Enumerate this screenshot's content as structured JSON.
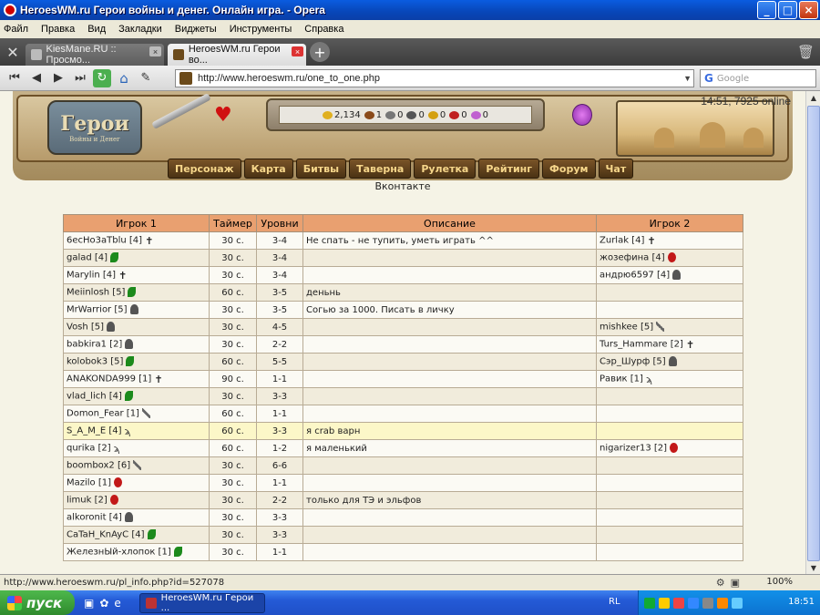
{
  "window": {
    "title": "HeroesWM.ru Герои войны и денег. Онлайн игра. - Opera",
    "minimize": "_",
    "maximize": "□",
    "close": "×"
  },
  "menu": [
    "Файл",
    "Правка",
    "Вид",
    "Закладки",
    "Виджеты",
    "Инструменты",
    "Справка"
  ],
  "tabs": [
    {
      "label": "KiesMane.RU :: Просмо...",
      "active": false
    },
    {
      "label": "HeroesWM.ru Герои во...",
      "active": true
    }
  ],
  "address": {
    "url": "http://www.heroeswm.ru/one_to_one.php",
    "search_placeholder": "Google",
    "search_engine": "G"
  },
  "game": {
    "logo_big": "Герои",
    "logo_small": "Войны и Денег",
    "clock": "14:51, 7925 online",
    "resources": [
      {
        "value": "2,134",
        "color": "#e0b020"
      },
      {
        "value": "1",
        "color": "#8a4a1a"
      },
      {
        "value": "0",
        "color": "#777777"
      },
      {
        "value": "0",
        "color": "#555555"
      },
      {
        "value": "0",
        "color": "#d4a010"
      },
      {
        "value": "0",
        "color": "#c02020"
      },
      {
        "value": "0",
        "color": "#c060d0"
      }
    ],
    "nav": [
      "Персонаж",
      "Карта",
      "Битвы",
      "Таверна",
      "Рулетка",
      "Рейтинг",
      "Форум",
      "Чат"
    ],
    "vk_link": "Вконтакте"
  },
  "table": {
    "headers": [
      "Игрок 1",
      "Таймер",
      "Уровни",
      "Описание",
      "Игрок 2"
    ],
    "rows": [
      {
        "p1": "6ecHo3aTblu [4]",
        "c1": "cross",
        "timer": "30 с.",
        "levels": "3-4",
        "desc": "Не спать - не тупить, уметь играть ^^",
        "p2": "Zurlak [4]",
        "c2": "cross"
      },
      {
        "p1": "galad [4]",
        "c1": "leaf",
        "timer": "30 с.",
        "levels": "3-4",
        "desc": "",
        "p2": "жозефина [4]",
        "c2": "x"
      },
      {
        "p1": "Marylin [4]",
        "c1": "cross",
        "timer": "30 с.",
        "levels": "3-4",
        "desc": "",
        "p2": "андрю6597 [4]",
        "c2": "helm"
      },
      {
        "p1": "Meiinlosh [5]",
        "c1": "leaf",
        "timer": "60 с.",
        "levels": "3-5",
        "desc": "деньнь",
        "p2": "",
        "c2": ""
      },
      {
        "p1": "MrWarrior [5]",
        "c1": "helm",
        "timer": "30 с.",
        "levels": "3-5",
        "desc": "Согью за 1000. Писать в личку",
        "p2": "",
        "c2": ""
      },
      {
        "p1": "Vosh [5]",
        "c1": "helm",
        "timer": "30 с.",
        "levels": "4-5",
        "desc": "",
        "p2": "mishkee [5]",
        "c2": "sword2"
      },
      {
        "p1": "babkira1 [2]",
        "c1": "helm",
        "timer": "30 с.",
        "levels": "2-2",
        "desc": "",
        "p2": "Turs_Hammare [2]",
        "c2": "cross"
      },
      {
        "p1": "kolobok3 [5]",
        "c1": "leaf",
        "timer": "60 с.",
        "levels": "5-5",
        "desc": "",
        "p2": "Сэр_Шурф [5]",
        "c2": "helm"
      },
      {
        "p1": "ANAKONDA999 [1]",
        "c1": "cross",
        "timer": "90 с.",
        "levels": "1-1",
        "desc": "",
        "p2": "Равик [1]",
        "c2": "wave"
      },
      {
        "p1": "vlad_lich [4]",
        "c1": "leaf",
        "timer": "30 с.",
        "levels": "3-3",
        "desc": "",
        "p2": "",
        "c2": ""
      },
      {
        "p1": "Domon_Fear [1]",
        "c1": "sword2",
        "timer": "60 с.",
        "levels": "1-1",
        "desc": "",
        "p2": "",
        "c2": ""
      },
      {
        "p1": "S_A_M_E [4]",
        "c1": "wave",
        "timer": "60 с.",
        "levels": "3-3",
        "desc": "я crab варн",
        "p2": "",
        "c2": "",
        "hl": true
      },
      {
        "p1": "qurika [2]",
        "c1": "wave",
        "timer": "60 с.",
        "levels": "1-2",
        "desc": "я маленький",
        "p2": "nigarizer13 [2]",
        "c2": "x"
      },
      {
        "p1": "boombox2 [6]",
        "c1": "sword2",
        "timer": "30 с.",
        "levels": "6-6",
        "desc": "",
        "p2": "",
        "c2": ""
      },
      {
        "p1": "Mazilo [1]",
        "c1": "x",
        "timer": "30 с.",
        "levels": "1-1",
        "desc": "",
        "p2": "",
        "c2": ""
      },
      {
        "p1": "limuk [2]",
        "c1": "x",
        "timer": "30 с.",
        "levels": "2-2",
        "desc": "только для ТЭ и эльфов",
        "p2": "",
        "c2": ""
      },
      {
        "p1": "alkoronit [4]",
        "c1": "helm",
        "timer": "30 с.",
        "levels": "3-3",
        "desc": "",
        "p2": "",
        "c2": ""
      },
      {
        "p1": "CaTaH_KnAyC [4]",
        "c1": "leaf",
        "timer": "30 с.",
        "levels": "3-3",
        "desc": "",
        "p2": "",
        "c2": ""
      },
      {
        "p1": "ЖелезнЫй-хлопок [1]",
        "c1": "leaf",
        "timer": "30 с.",
        "levels": "1-1",
        "desc": "",
        "p2": "",
        "c2": ""
      }
    ]
  },
  "status": {
    "link": "http://www.heroeswm.ru/pl_info.php?id=527078",
    "zoom": "100%"
  },
  "taskbar": {
    "start": "пуск",
    "task_label": "HeroesWM.ru Герои ...",
    "lang": "RL",
    "time": "18:51"
  }
}
